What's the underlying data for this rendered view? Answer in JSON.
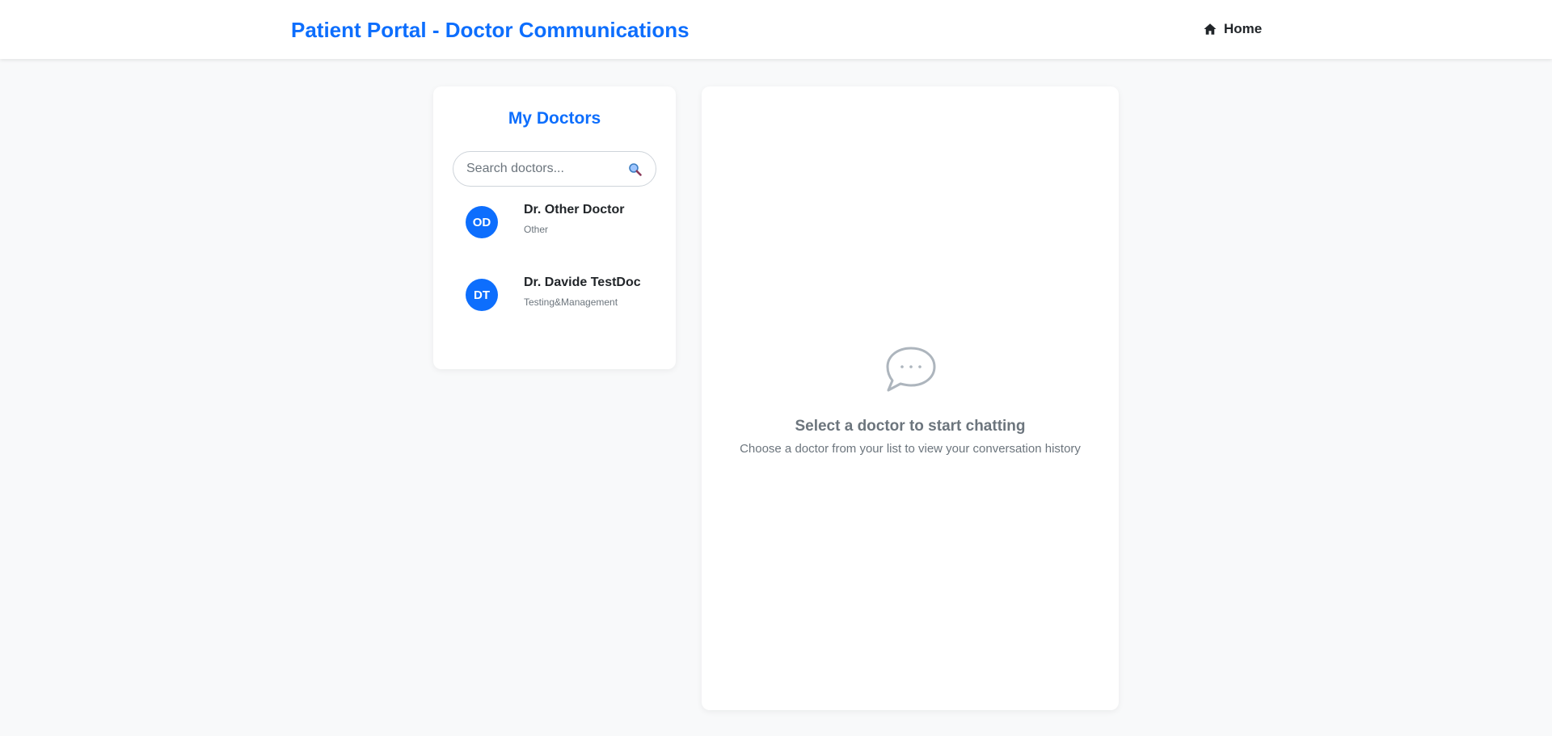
{
  "header": {
    "title": "Patient Portal - Doctor Communications",
    "home_label": "Home",
    "home_icon": "home-icon"
  },
  "doctors_panel": {
    "title": "My Doctors",
    "search": {
      "placeholder": "Search doctors...",
      "value": "",
      "icon": "search-icon"
    },
    "doctors": [
      {
        "initials": "OD",
        "name": "Dr. Other Doctor",
        "specialty": "Other"
      },
      {
        "initials": "DT",
        "name": "Dr. Davide TestDoc",
        "specialty": "Testing&Management"
      }
    ]
  },
  "chat_panel": {
    "empty_icon": "chat-bubble-icon",
    "empty_title": "Select a doctor to start chatting",
    "empty_subtitle": "Choose a doctor from your list to view your conversation history"
  },
  "colors": {
    "accent": "#0d6efd",
    "background": "#f8f9fa",
    "muted_text": "#6c757d"
  }
}
